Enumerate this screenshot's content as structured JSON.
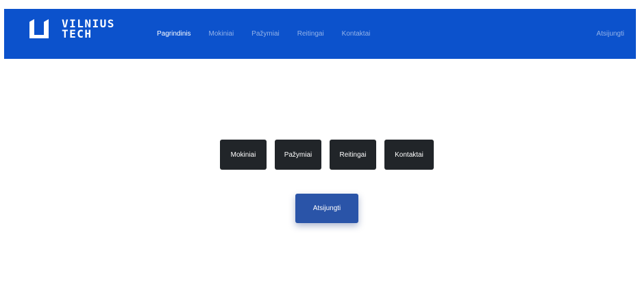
{
  "brand": {
    "line1": "VILNIUS",
    "line2": "TECH",
    "logo_icon": "vilniustech-logo-mark"
  },
  "nav": {
    "items": [
      {
        "label": "Pagrindinis",
        "active": true
      },
      {
        "label": "Mokiniai",
        "active": false
      },
      {
        "label": "Pažymiai",
        "active": false
      },
      {
        "label": "Reitingai",
        "active": false
      },
      {
        "label": "Kontaktai",
        "active": false
      }
    ],
    "logout": "Atsijungti"
  },
  "main": {
    "buttons": [
      {
        "label": "Mokiniai"
      },
      {
        "label": "Pažymiai"
      },
      {
        "label": "Reitingai"
      },
      {
        "label": "Kontaktai"
      }
    ],
    "logout_button": "Atsijungti"
  },
  "colors": {
    "navbar": "#0c52cc",
    "dark_button": "#212529",
    "primary_button": "#2a54a8"
  }
}
